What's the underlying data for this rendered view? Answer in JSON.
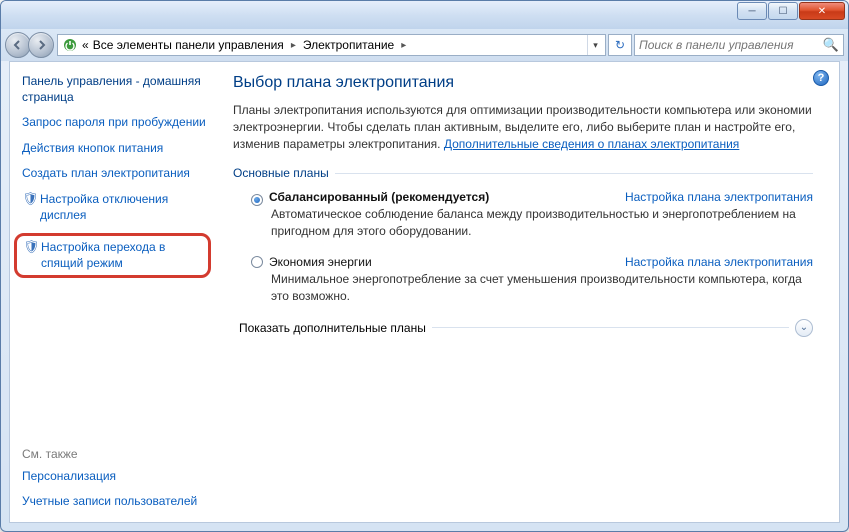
{
  "titlebar": {
    "min": "─",
    "max": "☐",
    "close": "✕"
  },
  "addr": {
    "crumb_prefix": "«",
    "crumb1": "Все элементы панели управления",
    "crumb2": "Электропитание",
    "dropdown": "▾"
  },
  "refresh_icon": "↻",
  "search": {
    "placeholder": "Поиск в панели управления",
    "icon": "🔍"
  },
  "sidebar": {
    "home": "Панель управления - домашняя страница",
    "links": [
      "Запрос пароля при пробуждении",
      "Действия кнопок питания",
      "Создать план электропитания"
    ],
    "display_off": "Настройка отключения дисплея",
    "sleep": "Настройка перехода в спящий режим",
    "see_also_label": "См. также",
    "see_also": [
      "Персонализация",
      "Учетные записи пользователей"
    ]
  },
  "main": {
    "help": "?",
    "title": "Выбор плана электропитания",
    "desc_text": "Планы электропитания используются для оптимизации производительности компьютера или экономии электроэнергии. Чтобы сделать план активным, выделите его, либо выберите план и настройте его, изменив параметры электропитания. ",
    "desc_link": "Дополнительные сведения о планах электропитания",
    "group_main": "Основные планы",
    "plans": [
      {
        "name": "Сбалансированный (рекомендуется)",
        "link": "Настройка плана электропитания",
        "desc": "Автоматическое соблюдение баланса между производительностью и энергопотреблением на пригодном для этого оборудовании.",
        "checked": true
      },
      {
        "name": "Экономия энергии",
        "link": "Настройка плана электропитания",
        "desc": "Минимальное энергопотребление за счет уменьшения производительности компьютера, когда это возможно.",
        "checked": false
      }
    ],
    "show_more": "Показать дополнительные планы",
    "expander_icon": "⌄"
  }
}
